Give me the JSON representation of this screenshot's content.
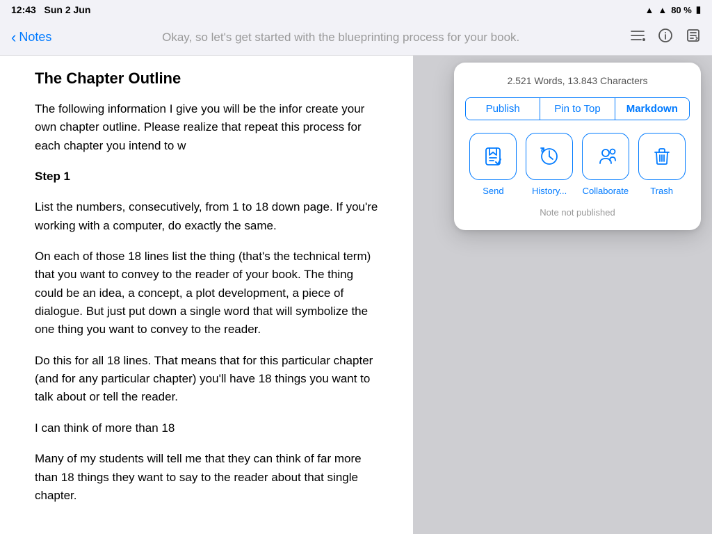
{
  "statusBar": {
    "time": "12:43",
    "date": "Sun 2 Jun",
    "battery": "80 %"
  },
  "navBar": {
    "backLabel": "Notes",
    "title": "Okay, so let's get started with the blueprinting process for your book.",
    "icons": {
      "list": "≡",
      "info": "ℹ",
      "compose": "✎"
    }
  },
  "note": {
    "heading": "The Chapter Outline",
    "paragraphs": [
      "The following information I give you will be the infor create your own chapter outline. Please realize that repeat this process for each chapter you intend to w",
      "",
      "List the numbers, consecutively, from 1 to 18 down page. If you're working with a computer, do exactly the same.",
      "On each of those 18 lines list the thing (that's the technical term) that you want to convey to the reader of your book. The thing could be an idea, a concept, a plot development, a piece of dialogue. But just put down a single word that will symbolize the one thing you want to convey to the reader.",
      "Do this for all 18 lines. That means that for this particular chapter (and for any particular chapter) you'll have 18 things you want to talk about or tell the reader.",
      "I can think of more than 18",
      "Many of my students will tell me that they can think of far more than 18 things they want to say to the reader about that single chapter."
    ],
    "step1": "Step 1"
  },
  "popup": {
    "stats": "2.521 Words, 13.843 Characters",
    "tabs": [
      {
        "label": "Publish",
        "active": false
      },
      {
        "label": "Pin to Top",
        "active": false
      },
      {
        "label": "Markdown",
        "active": true
      }
    ],
    "actions": [
      {
        "label": "Send",
        "icon": "send"
      },
      {
        "label": "History...",
        "icon": "history"
      },
      {
        "label": "Collaborate",
        "icon": "collaborate"
      },
      {
        "label": "Trash",
        "icon": "trash"
      }
    ],
    "footer": "Note not published"
  }
}
